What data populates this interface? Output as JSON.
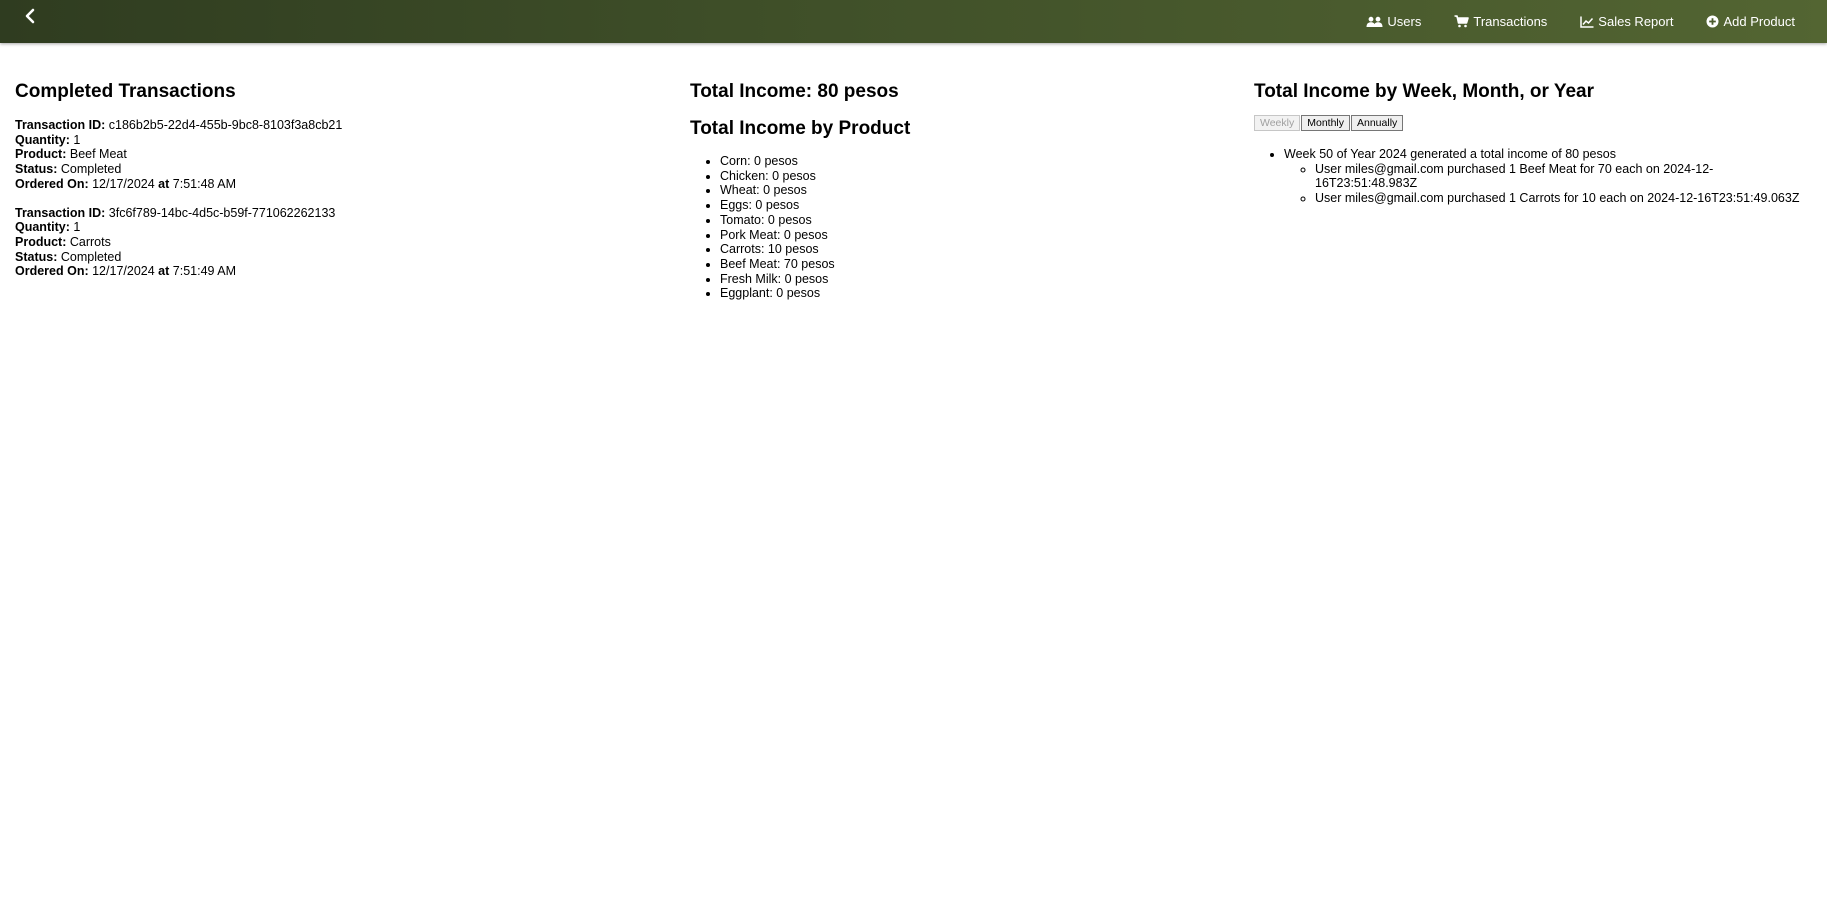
{
  "nav": {
    "users": "Users",
    "transactions": "Transactions",
    "sales_report": "Sales Report",
    "add_product": "Add Product"
  },
  "completed": {
    "title": "Completed Transactions",
    "labels": {
      "id": "Transaction ID:",
      "quantity": "Quantity:",
      "product": "Product:",
      "status": "Status:",
      "ordered_on": "Ordered On:",
      "at": "at"
    },
    "items": [
      {
        "id": "c186b2b5-22d4-455b-9bc8-8103f3a8cb21",
        "quantity": "1",
        "product": "Beef Meat",
        "status": "Completed",
        "date": "12/17/2024",
        "time": "7:51:48 AM"
      },
      {
        "id": "3fc6f789-14bc-4d5c-b59f-771062262133",
        "quantity": "1",
        "product": "Carrots",
        "status": "Completed",
        "date": "12/17/2024",
        "time": "7:51:49 AM"
      }
    ]
  },
  "income": {
    "total_title": "Total Income: 80 pesos",
    "by_product_title": "Total Income by Product",
    "products": [
      "Corn: 0 pesos",
      "Chicken: 0 pesos",
      "Wheat: 0 pesos",
      "Eggs: 0 pesos",
      "Tomato: 0 pesos",
      "Pork Meat: 0 pesos",
      "Carrots: 10 pesos",
      "Beef Meat: 70 pesos",
      "Fresh Milk: 0 pesos",
      "Eggplant: 0 pesos"
    ]
  },
  "period": {
    "title": "Total Income by Week, Month, or Year",
    "buttons": {
      "weekly": "Weekly",
      "monthly": "Monthly",
      "annually": "Annually"
    },
    "selected": "weekly",
    "week_summary": "Week 50 of Year 2024 generated a total income of 80 pesos",
    "details": [
      "User miles@gmail.com purchased 1 Beef Meat for 70 each on 2024-12-16T23:51:48.983Z",
      "User miles@gmail.com purchased 1 Carrots for 10 each on 2024-12-16T23:51:49.063Z"
    ]
  },
  "colors": {
    "topbar_start": "#2f3c20",
    "topbar_end": "#536532",
    "nav_text": "#ffffff"
  }
}
